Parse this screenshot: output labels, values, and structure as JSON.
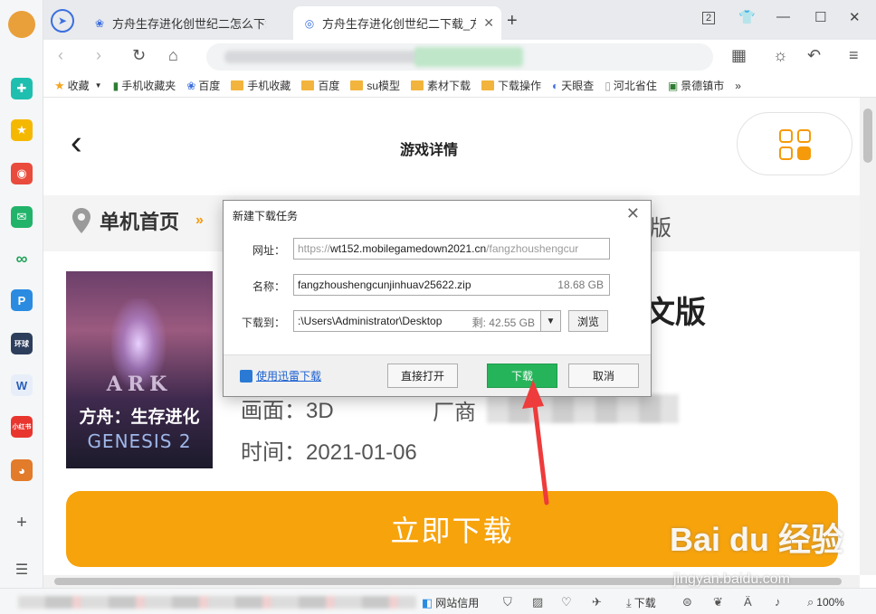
{
  "browser": {
    "tabs": [
      {
        "title": "方舟生存进化创世纪二怎么下载",
        "active": false
      },
      {
        "title": "方舟生存进化创世纪二下载_方舟",
        "active": true
      }
    ],
    "new_tab": "+",
    "tab_count": "2",
    "bookmarks": [
      "收藏",
      "手机收藏夹",
      "百度",
      "手机收藏",
      "百度",
      "su模型",
      "素材下载",
      "下载操作",
      "天眼查",
      "河北省住",
      "景德镇市"
    ],
    "bookmarks_more": "»"
  },
  "page": {
    "header_title": "游戏详情",
    "breadcrumb_home": "单机首页",
    "breadcrumb_tail": "版",
    "game_title_tail": "文版",
    "picture_label": "画面：",
    "picture_value": "3D",
    "vendor_label": "厂商",
    "time_label": "时间：",
    "time_value": "2021-01-06",
    "download_button": "立即下载",
    "cover": {
      "logo": "ARK",
      "cn_title": "方舟：生存进化",
      "subtitle": "GENESIS 2"
    }
  },
  "dialog": {
    "title": "新建下载任务",
    "url_label": "网址：",
    "url_prefix": "https://",
    "url_host": "wt152.mobilegamedown2021.cn",
    "url_path": "/fangzhoushengcur",
    "name_label": "名称：",
    "name_value": "fangzhoushengcunjinhuav25622.zip",
    "name_size": "18.68 GB",
    "save_label": "下载到：",
    "save_path": ":\\Users\\Administrator\\Desktop",
    "save_free": "剩: 42.55 GB",
    "browse_button": "浏览",
    "xunlei_link": "使用迅雷下载",
    "open_button": "直接打开",
    "download_button": "下载",
    "cancel_button": "取消"
  },
  "statusbar": {
    "site_credit": "网站信用",
    "downloads": "下载",
    "zoom": "100%"
  },
  "watermark": {
    "brand": "Bai du 经验",
    "url": "jingyan.baidu.com"
  }
}
